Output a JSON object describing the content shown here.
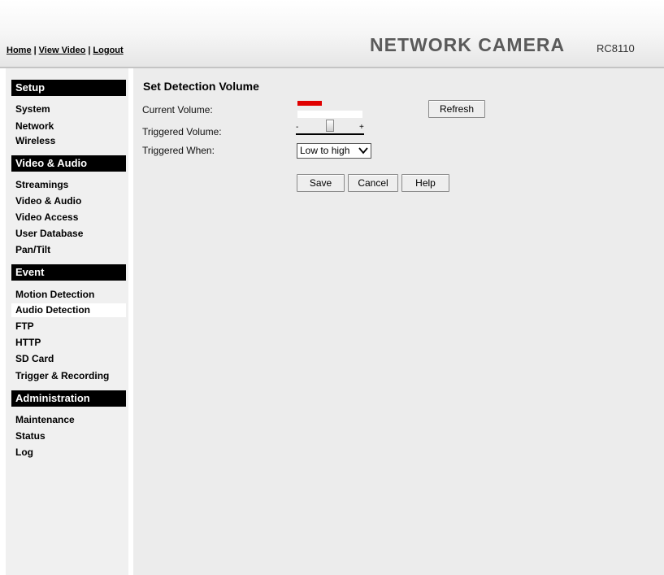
{
  "header": {
    "links": [
      "Home",
      "View Video",
      "Logout"
    ],
    "separator": "|",
    "brand": "NETWORK CAMERA",
    "model": "RC8110"
  },
  "sidebar": {
    "sections": [
      {
        "title": "Setup",
        "items": [
          "System",
          "Network",
          "Wireless"
        ]
      },
      {
        "title": "Video & Audio",
        "items": [
          "Streamings",
          "Video & Audio",
          "Video Access",
          "User Database",
          "Pan/Tilt"
        ]
      },
      {
        "title": "Event",
        "items": [
          "Motion Detection",
          "Audio Detection",
          "FTP",
          "HTTP",
          "SD Card",
          "Trigger & Recording"
        ]
      },
      {
        "title": "Administration",
        "items": [
          "Maintenance",
          "Status",
          "Log"
        ]
      }
    ],
    "active_item": "Audio Detection"
  },
  "main": {
    "title": "Set Detection Volume",
    "current_volume_label": "Current Volume:",
    "triggered_volume_label": "Triggered Volume:",
    "triggered_when_label": "Triggered When:",
    "refresh_label": "Refresh",
    "slider_min": "-",
    "slider_max": "+",
    "triggered_when_value": "Low to high",
    "save_label": "Save",
    "cancel_label": "Cancel",
    "help_label": "Help"
  },
  "colors": {
    "volume_indicator": "#e00000",
    "section_header_bg": "#000000",
    "content_bg": "#ececec"
  }
}
